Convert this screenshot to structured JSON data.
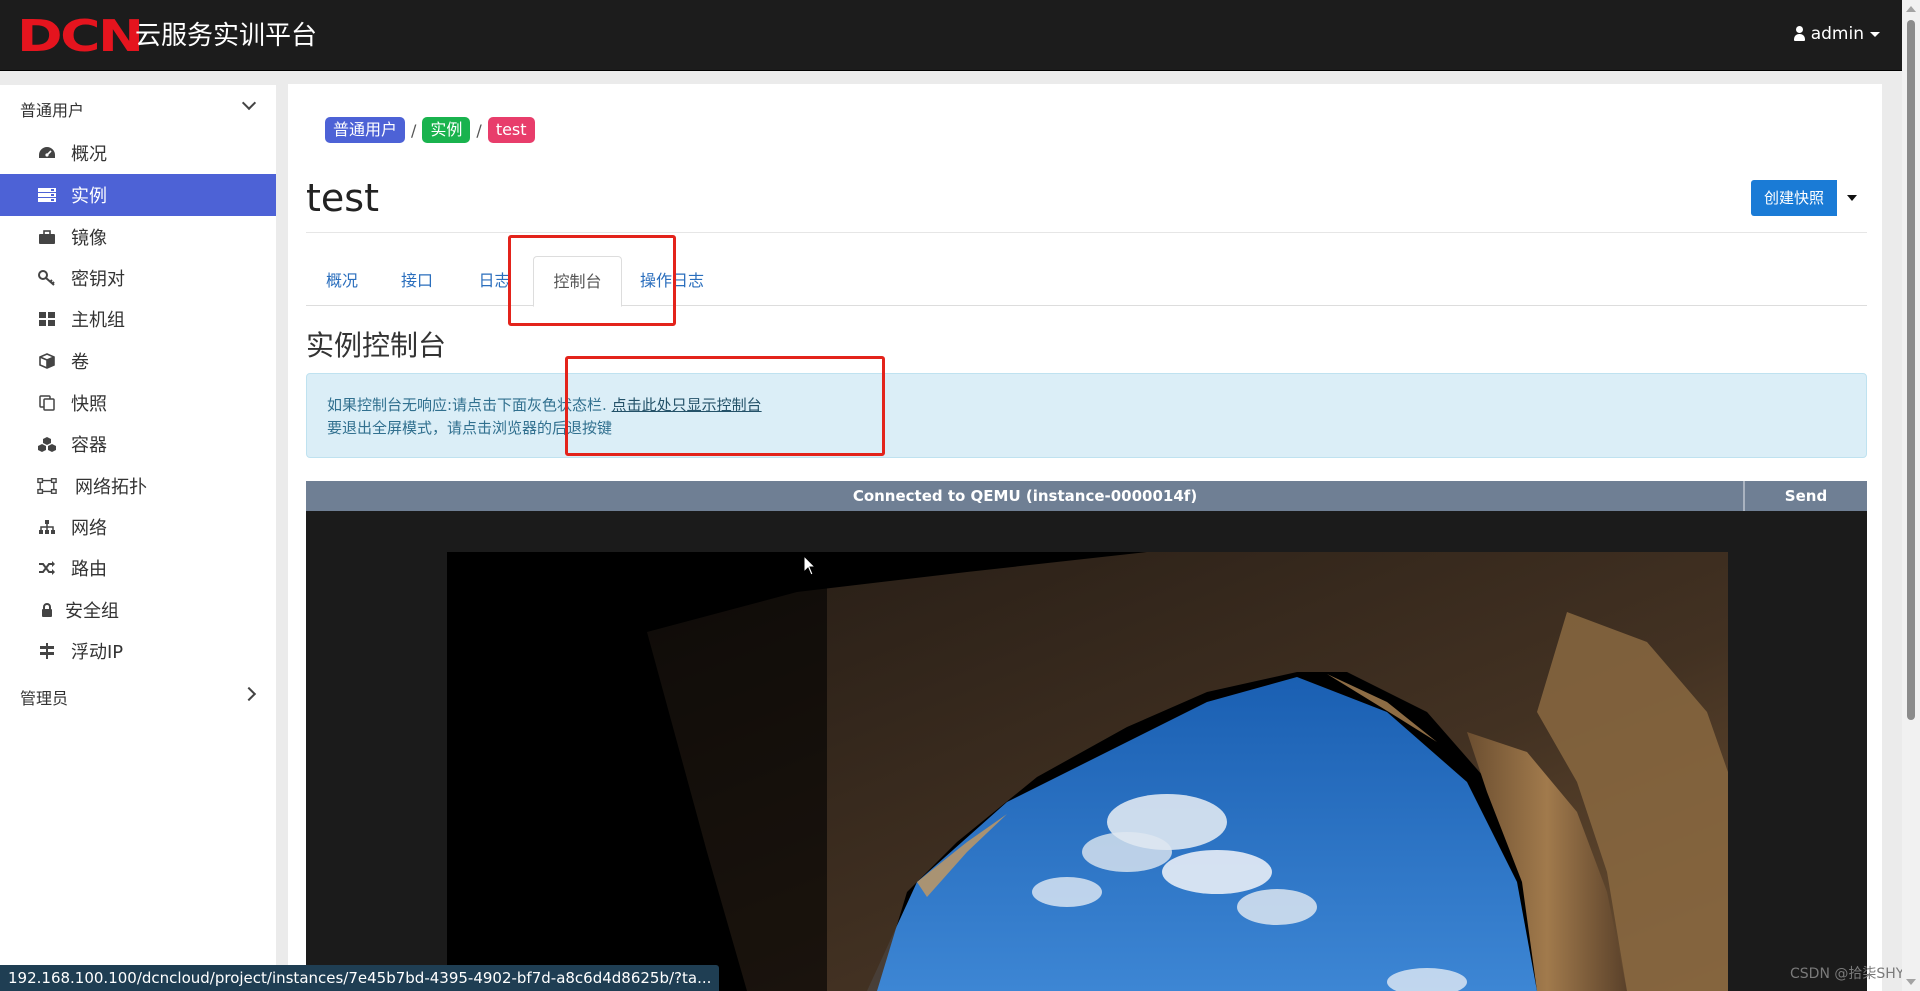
{
  "brand": {
    "logo_text": "DCN",
    "platform_name": "云服务实训平台",
    "logo_color": "#e5141e"
  },
  "user_menu": {
    "label": "admin"
  },
  "sidebar": {
    "user_section": "普通用户",
    "admin_section": "管理员",
    "items": [
      {
        "label": "概况",
        "icon": "dashboard-icon"
      },
      {
        "label": "实例",
        "icon": "server-icon",
        "active": true
      },
      {
        "label": "镜像",
        "icon": "briefcase-icon"
      },
      {
        "label": "密钥对",
        "icon": "key-icon"
      },
      {
        "label": "主机组",
        "icon": "grid-icon"
      },
      {
        "label": "卷",
        "icon": "cube-icon"
      },
      {
        "label": "快照",
        "icon": "copy-icon"
      },
      {
        "label": "容器",
        "icon": "cubes-icon"
      },
      {
        "label": "网络拓扑",
        "icon": "topology-icon"
      },
      {
        "label": "网络",
        "icon": "sitemap-icon"
      },
      {
        "label": "路由",
        "icon": "random-icon"
      },
      {
        "label": "安全组",
        "icon": "lock-icon"
      },
      {
        "label": "浮动IP",
        "icon": "signpost-icon"
      }
    ]
  },
  "breadcrumb": {
    "items": [
      "普通用户",
      "实例",
      "test"
    ],
    "separator": "/"
  },
  "page": {
    "title": "test",
    "create_snapshot": "创建快照"
  },
  "tabs": [
    "概况",
    "接口",
    "日志",
    "控制台",
    "操作日志"
  ],
  "active_tab": "控制台",
  "console": {
    "section_title": "实例控制台",
    "alert_line1": "如果控制台无响应:请点击下面灰色状态栏.",
    "alert_link": "点击此处只显示控制台",
    "alert_line2": "要退出全屏模式，请点击浏览器的后退按键",
    "status": "Connected to QEMU (instance-0000014f)",
    "send_cad": "Send CtrlAltDel"
  },
  "browser_status_url": "192.168.100.100/dcncloud/project/instances/7e45b7bd-4395-4902-bf7d-a8c6d4d8625b/?ta...",
  "watermark": "CSDN @拾柒SHY",
  "colors": {
    "accent": "#4d62d6",
    "annotation": "#e3231b",
    "primary_button": "#1a7bd6"
  }
}
